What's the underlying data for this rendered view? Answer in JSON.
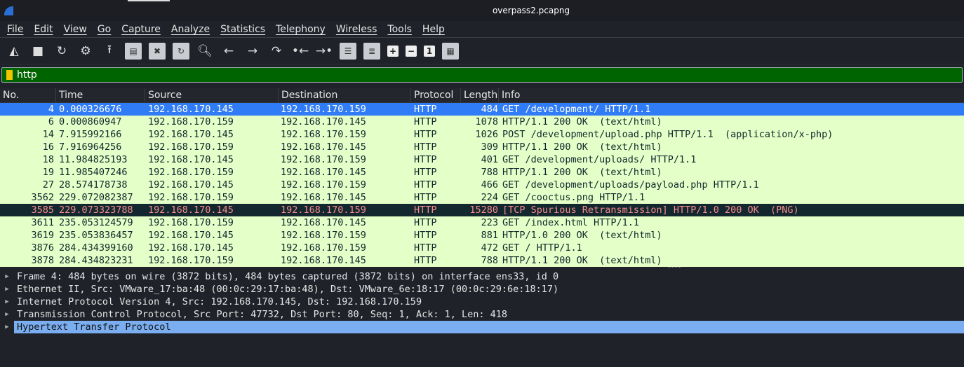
{
  "window": {
    "title": "overpass2.pcapng"
  },
  "menu": [
    "File",
    "Edit",
    "View",
    "Go",
    "Capture",
    "Analyze",
    "Statistics",
    "Telephony",
    "Wireless",
    "Tools",
    "Help"
  ],
  "toolbar": {
    "icons": [
      "start-capture-icon",
      "stop-capture-icon",
      "restart-capture-icon",
      "capture-options-icon",
      "open-file-icon",
      "save-file-icon",
      "close-file-icon",
      "reload-file-icon",
      "find-packet-icon",
      "go-back-icon",
      "go-forward-icon",
      "go-to-packet-icon",
      "first-packet-icon",
      "last-packet-icon",
      "autoscroll-icon",
      "colorize-icon",
      "zoom-in-icon",
      "zoom-out-icon",
      "normal-size-icon",
      "resize-columns-icon"
    ]
  },
  "filter": {
    "value": "http"
  },
  "columns": [
    "No.",
    "Time",
    "Source",
    "Destination",
    "Protocol",
    "Length",
    "Info"
  ],
  "packets": [
    {
      "no": "4",
      "time": "0.000326676",
      "src": "192.168.170.145",
      "dst": "192.168.170.159",
      "proto": "HTTP",
      "len": "484",
      "info": "GET /development/ HTTP/1.1",
      "state": "sel"
    },
    {
      "no": "6",
      "time": "0.000860947",
      "src": "192.168.170.159",
      "dst": "192.168.170.145",
      "proto": "HTTP",
      "len": "1078",
      "info": "HTTP/1.1 200 OK  (text/html)"
    },
    {
      "no": "14",
      "time": "7.915992166",
      "src": "192.168.170.145",
      "dst": "192.168.170.159",
      "proto": "HTTP",
      "len": "1026",
      "info": "POST /development/upload.php HTTP/1.1  (application/x-php)"
    },
    {
      "no": "16",
      "time": "7.916964256",
      "src": "192.168.170.159",
      "dst": "192.168.170.145",
      "proto": "HTTP",
      "len": "309",
      "info": "HTTP/1.1 200 OK  (text/html)"
    },
    {
      "no": "18",
      "time": "11.984825193",
      "src": "192.168.170.145",
      "dst": "192.168.170.159",
      "proto": "HTTP",
      "len": "401",
      "info": "GET /development/uploads/ HTTP/1.1"
    },
    {
      "no": "19",
      "time": "11.985407246",
      "src": "192.168.170.159",
      "dst": "192.168.170.145",
      "proto": "HTTP",
      "len": "788",
      "info": "HTTP/1.1 200 OK  (text/html)"
    },
    {
      "no": "27",
      "time": "28.574178738",
      "src": "192.168.170.145",
      "dst": "192.168.170.159",
      "proto": "HTTP",
      "len": "466",
      "info": "GET /development/uploads/payload.php HTTP/1.1"
    },
    {
      "no": "3562",
      "time": "229.072082387",
      "src": "192.168.170.159",
      "dst": "192.168.170.145",
      "proto": "HTTP",
      "len": "224",
      "info": "GET /cooctus.png HTTP/1.1"
    },
    {
      "no": "3585",
      "time": "229.073323788",
      "src": "192.168.170.145",
      "dst": "192.168.170.159",
      "proto": "HTTP",
      "len": "15280",
      "info": "[TCP Spurious Retransmission] HTTP/1.0 200 OK  (PNG)",
      "state": "err"
    },
    {
      "no": "3611",
      "time": "235.053124579",
      "src": "192.168.170.159",
      "dst": "192.168.170.145",
      "proto": "HTTP",
      "len": "223",
      "info": "GET /index.html HTTP/1.1"
    },
    {
      "no": "3619",
      "time": "235.053836457",
      "src": "192.168.170.145",
      "dst": "192.168.170.159",
      "proto": "HTTP",
      "len": "881",
      "info": "HTTP/1.0 200 OK  (text/html)"
    },
    {
      "no": "3876",
      "time": "284.434399160",
      "src": "192.168.170.145",
      "dst": "192.168.170.159",
      "proto": "HTTP",
      "len": "472",
      "info": "GET / HTTP/1.1"
    },
    {
      "no": "3878",
      "time": "284.434823231",
      "src": "192.168.170.159",
      "dst": "192.168.170.145",
      "proto": "HTTP",
      "len": "788",
      "info": "HTTP/1.1 200 OK  (text/html)"
    }
  ],
  "details": [
    "Frame 4: 484 bytes on wire (3872 bits), 484 bytes captured (3872 bits) on interface ens33, id 0",
    "Ethernet II, Src: VMware_17:ba:48 (00:0c:29:17:ba:48), Dst: VMware_6e:18:17 (00:0c:29:6e:18:17)",
    "Internet Protocol Version 4, Src: 192.168.170.145, Dst: 192.168.170.159",
    "Transmission Control Protocol, Src Port: 47732, Dst Port: 80, Seq: 1, Ack: 1, Len: 418",
    "Hypertext Transfer Protocol"
  ],
  "colors": {
    "row_bg": "#e4ffc7",
    "selected": "#2f7cf6",
    "error_bg": "#12272e",
    "error_fg": "#f78c8c",
    "filter_valid": "#006400"
  }
}
